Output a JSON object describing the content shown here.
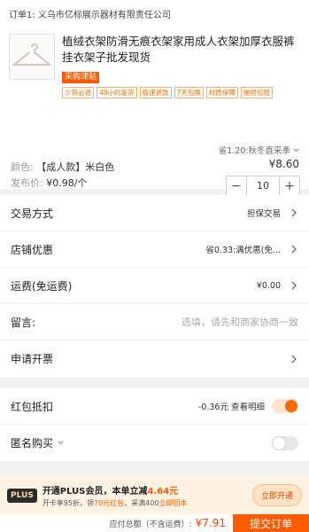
{
  "order": {
    "header": "订单1: 义乌市亿标展示器材有限责任公司"
  },
  "product": {
    "title": "植绒衣架防滑无痕衣架家用成人衣架加厚衣服裤挂衣架子批发现货",
    "sticker": "采购津贴",
    "tags": [
      "少货必退",
      "48小时发货",
      "极速退款",
      "7天包换",
      "材质保障",
      "破损包赔"
    ],
    "saving": "省1.20:秋冬直采季",
    "spec_label": "颜色:",
    "spec_value": "【成人款】米白色",
    "price": "¥8.60",
    "ship_label": "发布价:",
    "ship_value": "¥0.98/个",
    "quantity": "10"
  },
  "rows": {
    "trade": {
      "label": "交易方式",
      "value": "担保交易"
    },
    "shop": {
      "label": "店铺优惠",
      "value": "省0.33:满优惠(免..."
    },
    "freight": {
      "label": "运费(免运费)",
      "value": "¥0.00"
    },
    "message": {
      "label": "留言:",
      "placeholder": "选填，请先和商家协商一致"
    },
    "invoice": {
      "label": "申请开票"
    },
    "redpacket": {
      "label": "红包抵扣",
      "value": "-0.36元 查看明细"
    },
    "anonymous": {
      "label": "匿名购买"
    }
  },
  "plus": {
    "badge": "PLUS",
    "title_prefix": "开通PLUS会员，本单立减",
    "title_amount": "4.64元",
    "sub_prefix": "开卡享95折，领",
    "sub_hl1": "70元红包",
    "sub_mid": "，采满400",
    "sub_hl2": "立即回本",
    "button": "立即开通"
  },
  "footer": {
    "total_label": "应付总额（不含运费）:",
    "total": "¥7.91",
    "submit": "提交订单"
  },
  "colors": {
    "accent": "#ff5a00"
  }
}
